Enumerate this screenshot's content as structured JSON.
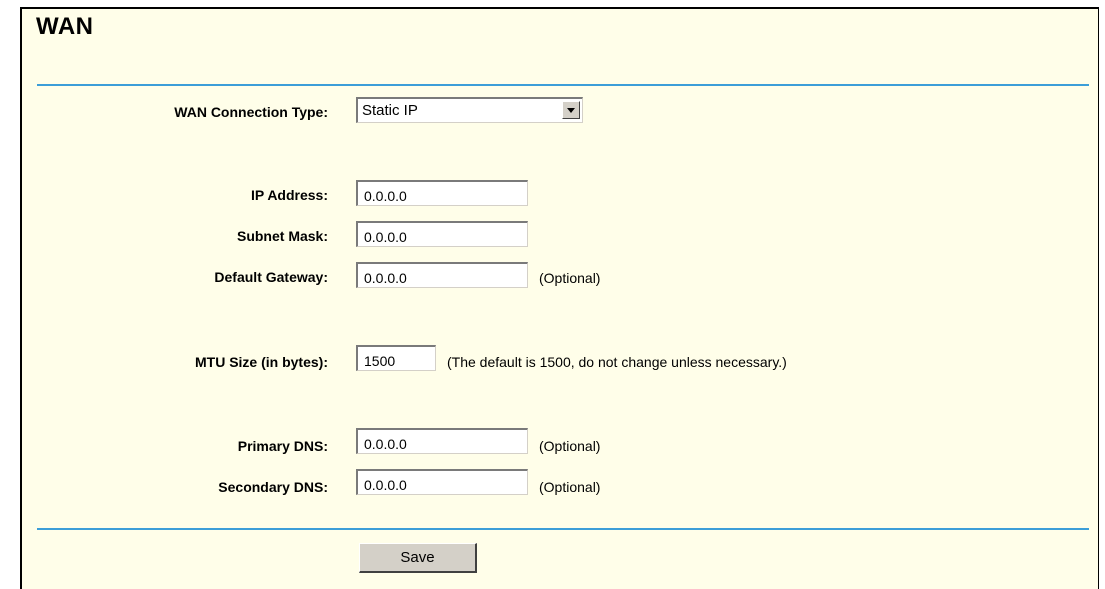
{
  "page": {
    "title": "WAN"
  },
  "form": {
    "connection_type": {
      "label": "WAN Connection Type:",
      "value": "Static IP"
    },
    "ip_address": {
      "label": "IP Address:",
      "value": "0.0.0.0"
    },
    "subnet_mask": {
      "label": "Subnet Mask:",
      "value": "0.0.0.0"
    },
    "default_gateway": {
      "label": "Default Gateway:",
      "value": "0.0.0.0",
      "note": "(Optional)"
    },
    "mtu": {
      "label": "MTU Size (in bytes):",
      "value": "1500",
      "note": "(The default is 1500, do not change unless necessary.)"
    },
    "primary_dns": {
      "label": "Primary DNS:",
      "value": "0.0.0.0",
      "note": "(Optional)"
    },
    "secondary_dns": {
      "label": "Secondary DNS:",
      "value": "0.0.0.0",
      "note": "(Optional)"
    },
    "save_label": "Save"
  },
  "icons": {
    "dropdown": "chevron-down-icon"
  },
  "colors": {
    "background": "#fffee9",
    "divider": "#3c9ed8",
    "button": "#d4d0c8"
  }
}
